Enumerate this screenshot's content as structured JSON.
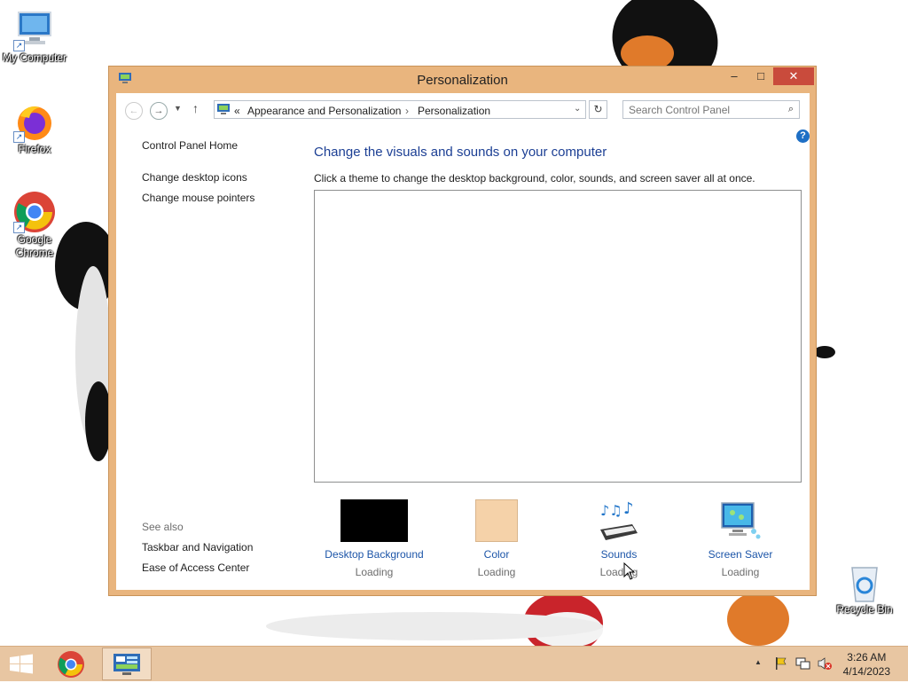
{
  "desktop": {
    "icons": [
      {
        "label": "My Computer"
      },
      {
        "label": "Firefox"
      },
      {
        "label": "Google Chrome"
      },
      {
        "label": "Recycle Bin"
      }
    ]
  },
  "window": {
    "title": "Personalization",
    "controls": {
      "minimize": "–",
      "maximize": "□",
      "close": "✕"
    },
    "address": {
      "chevron": "«",
      "crumbs": [
        "Appearance and Personalization",
        "Personalization"
      ],
      "separator": "›"
    },
    "search": {
      "placeholder": "Search Control Panel"
    },
    "left_pane": {
      "home": "Control Panel Home",
      "links": [
        "Change desktop icons",
        "Change mouse pointers"
      ],
      "see_also_label": "See also",
      "see_also": [
        "Taskbar and Navigation",
        "Ease of Access Center"
      ]
    },
    "main": {
      "heading": "Change the visuals and sounds on your computer",
      "subtext": "Click a theme to change the desktop background, color, sounds, and screen saver all at once.",
      "help": "?",
      "tiles": [
        {
          "name": "Desktop Background",
          "status": "Loading",
          "color": "#000000"
        },
        {
          "name": "Color",
          "status": "Loading",
          "color": "#f5d2a9"
        },
        {
          "name": "Sounds",
          "status": "Loading"
        },
        {
          "name": "Screen Saver",
          "status": "Loading"
        }
      ]
    }
  },
  "taskbar": {
    "time": "3:26 AM",
    "date": "4/14/2023",
    "tray_chevron": "▲"
  }
}
